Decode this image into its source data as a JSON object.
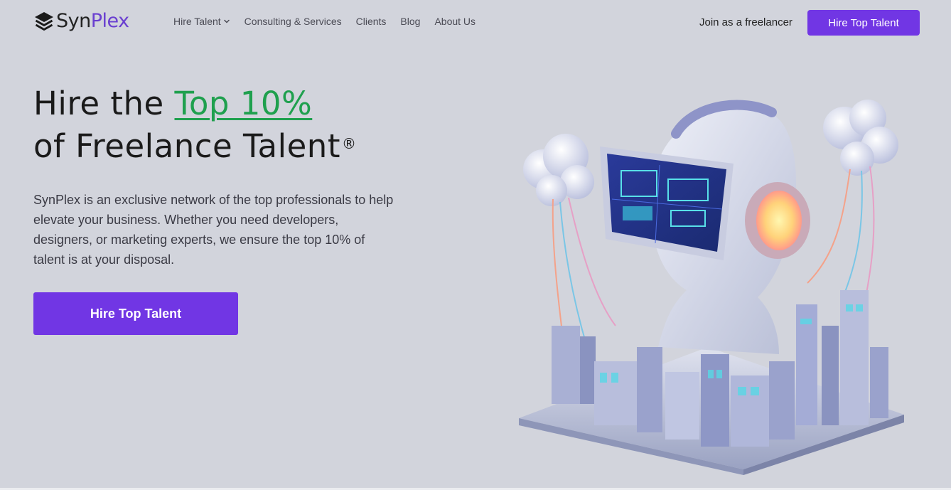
{
  "brand": {
    "name_part1": "Syn",
    "name_part2": "Plex"
  },
  "nav": {
    "items": [
      {
        "label": "Hire Talent",
        "has_dropdown": true
      },
      {
        "label": "Consulting & Services"
      },
      {
        "label": "Clients"
      },
      {
        "label": "Blog"
      },
      {
        "label": "About Us"
      }
    ]
  },
  "header": {
    "join_label": "Join as a freelancer",
    "hire_button_label": "Hire Top Talent"
  },
  "hero": {
    "headline_prefix": "Hire the ",
    "headline_accent": "Top 10%",
    "headline_line2": "of Freelance Talent",
    "registered_mark": "®",
    "description": "SynPlex is an exclusive network of the top professionals to help elevate your business. Whether you need developers, designers, or marketing experts, we ensure the top 10% of talent is at your disposal.",
    "cta_label": "Hire Top Talent",
    "illustration_icon": "robot-city-illustration"
  },
  "colors": {
    "background": "#d2d4dc",
    "primary": "#7136e4",
    "accent_green": "#1fa04e",
    "brand_purple": "#6a3fd0"
  }
}
